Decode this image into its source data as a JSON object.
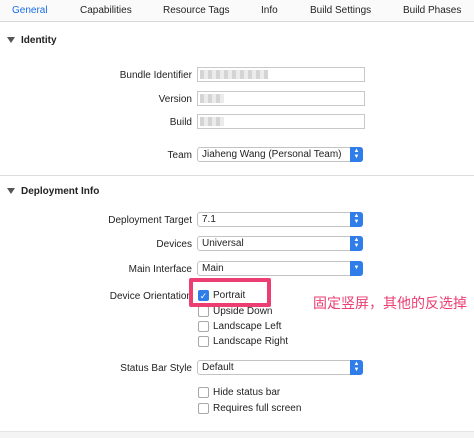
{
  "tabs": [
    {
      "label": "General",
      "active": true
    },
    {
      "label": "Capabilities"
    },
    {
      "label": "Resource Tags"
    },
    {
      "label": "Info"
    },
    {
      "label": "Build Settings"
    },
    {
      "label": "Build Phases"
    }
  ],
  "identity": {
    "title": "Identity",
    "bundle_identifier_label": "Bundle Identifier",
    "version_label": "Version",
    "build_label": "Build",
    "team_label": "Team",
    "team_value": "Jiaheng Wang (Personal Team)"
  },
  "deployment": {
    "title": "Deployment Info",
    "target_label": "Deployment Target",
    "target_value": "7.1",
    "devices_label": "Devices",
    "devices_value": "Universal",
    "main_interface_label": "Main Interface",
    "main_interface_value": "Main",
    "orientation_label": "Device Orientation",
    "orientations": [
      {
        "label": "Portrait",
        "checked": true
      },
      {
        "label": "Upside Down",
        "checked": false
      },
      {
        "label": "Landscape Left",
        "checked": false
      },
      {
        "label": "Landscape Right",
        "checked": false
      }
    ],
    "status_bar_label": "Status Bar Style",
    "status_bar_value": "Default",
    "hide_status_bar_label": "Hide status bar",
    "requires_full_screen_label": "Requires full screen"
  },
  "annotation": "固定竖屏，其他的反选掉",
  "colors": {
    "accent": "#2e7de9",
    "annotation": "#ec3e72",
    "active_tab": "#1a6ee8"
  }
}
